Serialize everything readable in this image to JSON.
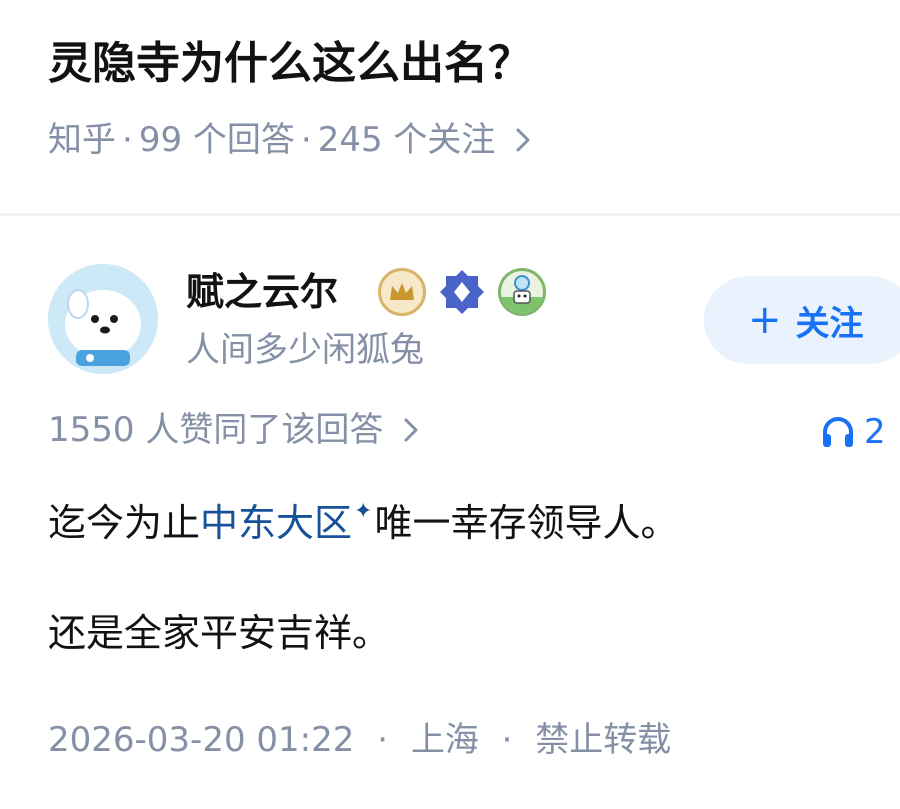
{
  "question": {
    "title": "灵隐寺为什么这么出名？",
    "source": "知乎",
    "answers_count": "99 个回答",
    "followers_count": "245 个关注"
  },
  "author": {
    "name": "赋之云尔",
    "bio": "人间多少闲狐兔",
    "badges": [
      "crown-badge-icon",
      "blue-diamond-badge-icon",
      "pet-avatar-badge-icon"
    ]
  },
  "follow_button": {
    "label": "关注"
  },
  "answer": {
    "votes_text": "1550 人赞同了该回答",
    "listen_count": "2",
    "para1_before": "迄今为止",
    "para1_link": "中东大区",
    "para1_after": "唯一幸存领导人。",
    "para2": "还是全家平安吉祥。"
  },
  "footer": {
    "time": "2026-03-20 01:22",
    "location": "上海",
    "copyright": "禁止转载"
  },
  "colors": {
    "accent": "#1772f6",
    "link": "#175199",
    "meta_gray": "#8590a6",
    "follow_bg": "#eaf2fd"
  }
}
